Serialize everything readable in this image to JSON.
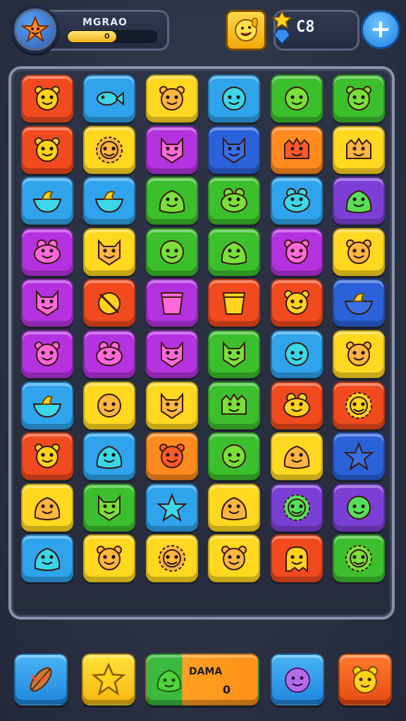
{
  "hud": {
    "player_name": "MGRAO",
    "xp_text": "0",
    "xp_fraction": 0.55,
    "gem_count": "C8",
    "plus_label": "+",
    "avatar_icon": "star-face-icon",
    "reward_icon": "thumbs-up-smile-icon"
  },
  "colors": {
    "red": "#f04a1e",
    "blue": "#2fa3ec",
    "yellow": "#ffd81f",
    "green": "#3cbf2c",
    "orange": "#ff8a1e",
    "purple": "#b532e0",
    "violet": "#7c3fd6",
    "navy": "#2b62d9"
  },
  "board": {
    "rows": [
      [
        {
          "c": "red",
          "i": "bear"
        },
        {
          "c": "blue",
          "i": "fish"
        },
        {
          "c": "yellow",
          "i": "bear"
        },
        {
          "c": "blue",
          "i": "round"
        },
        {
          "c": "green",
          "i": "round"
        },
        {
          "c": "green",
          "i": "bear"
        }
      ],
      [
        {
          "c": "red",
          "i": "bear"
        },
        {
          "c": "yellow",
          "i": "lion"
        },
        {
          "c": "purple",
          "i": "cat"
        },
        {
          "c": "navy",
          "i": "cat"
        },
        {
          "c": "orange",
          "i": "monster"
        },
        {
          "c": "yellow",
          "i": "monster"
        }
      ],
      [
        {
          "c": "blue",
          "i": "bowl"
        },
        {
          "c": "blue",
          "i": "bowl"
        },
        {
          "c": "green",
          "i": "blob"
        },
        {
          "c": "green",
          "i": "frog"
        },
        {
          "c": "blue",
          "i": "frog"
        },
        {
          "c": "violet",
          "i": "blob"
        }
      ],
      [
        {
          "c": "purple",
          "i": "frog"
        },
        {
          "c": "yellow",
          "i": "cat"
        },
        {
          "c": "green",
          "i": "round"
        },
        {
          "c": "green",
          "i": "blob"
        },
        {
          "c": "purple",
          "i": "bear"
        },
        {
          "c": "yellow",
          "i": "bear"
        }
      ],
      [
        {
          "c": "purple",
          "i": "cat"
        },
        {
          "c": "red",
          "i": "ball"
        },
        {
          "c": "purple",
          "i": "cup"
        },
        {
          "c": "red",
          "i": "cup"
        },
        {
          "c": "red",
          "i": "bear"
        },
        {
          "c": "navy",
          "i": "bowl"
        }
      ],
      [
        {
          "c": "purple",
          "i": "bear"
        },
        {
          "c": "purple",
          "i": "frog"
        },
        {
          "c": "purple",
          "i": "cat"
        },
        {
          "c": "green",
          "i": "cat"
        },
        {
          "c": "blue",
          "i": "round"
        },
        {
          "c": "yellow",
          "i": "bear"
        }
      ],
      [
        {
          "c": "blue",
          "i": "bowl"
        },
        {
          "c": "yellow",
          "i": "round"
        },
        {
          "c": "yellow",
          "i": "cat"
        },
        {
          "c": "green",
          "i": "monster"
        },
        {
          "c": "red",
          "i": "frog"
        },
        {
          "c": "red",
          "i": "lion"
        }
      ],
      [
        {
          "c": "red",
          "i": "bear"
        },
        {
          "c": "blue",
          "i": "blob"
        },
        {
          "c": "orange",
          "i": "bear"
        },
        {
          "c": "green",
          "i": "round"
        },
        {
          "c": "yellow",
          "i": "blob"
        },
        {
          "c": "navy",
          "i": "star"
        }
      ],
      [
        {
          "c": "yellow",
          "i": "blob"
        },
        {
          "c": "green",
          "i": "cat"
        },
        {
          "c": "blue",
          "i": "star"
        },
        {
          "c": "yellow",
          "i": "blob"
        },
        {
          "c": "violet",
          "i": "lion"
        },
        {
          "c": "violet",
          "i": "round"
        }
      ],
      [
        {
          "c": "blue",
          "i": "blob"
        },
        {
          "c": "yellow",
          "i": "bear"
        },
        {
          "c": "yellow",
          "i": "lion"
        },
        {
          "c": "yellow",
          "i": "bear"
        },
        {
          "c": "red",
          "i": "ghost"
        },
        {
          "c": "green",
          "i": "lion"
        }
      ]
    ]
  },
  "bottom": {
    "left_btn_icon": "feather-icon",
    "star_btn_icon": "star-icon",
    "center_label": "DAMA",
    "center_value": "0",
    "center_icon": "green-blob-icon",
    "monster_btn_icon": "fuzzy-monster-icon",
    "bear_btn_icon": "bear-icon"
  }
}
